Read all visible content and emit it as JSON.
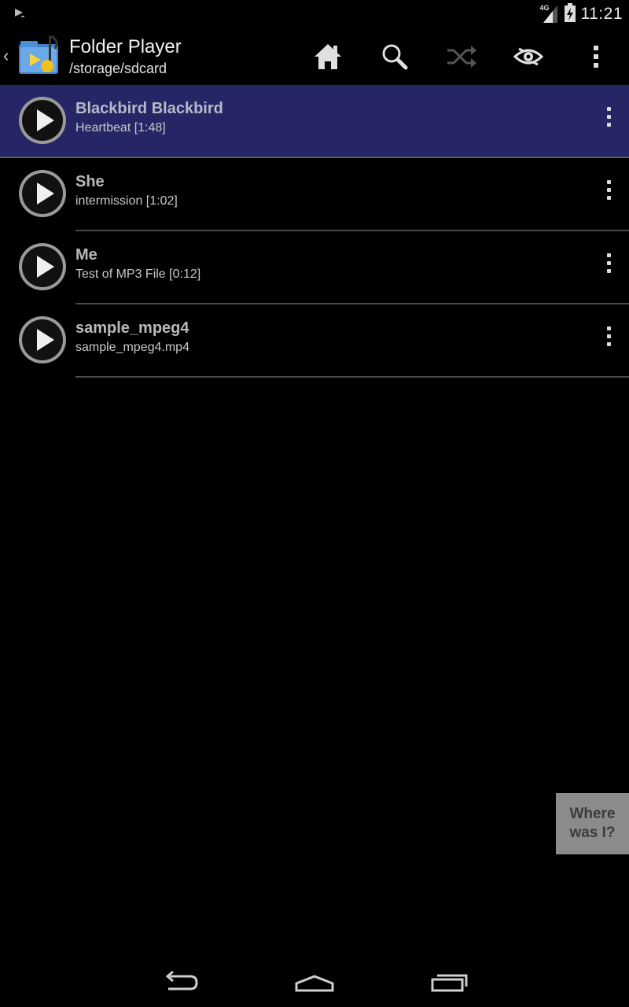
{
  "status_bar": {
    "network_type": "4G",
    "time": "11:21",
    "notification_icon": "play-store-icon",
    "signal_icon": "signal-icon",
    "battery_icon": "battery-charging-icon"
  },
  "action_bar": {
    "title": "Folder Player",
    "subtitle": "/storage/sdcard",
    "buttons": [
      "home-icon",
      "search-icon",
      "shuffle-icon",
      "eye-repeat-icon",
      "overflow-menu-icon"
    ]
  },
  "tracks": [
    {
      "title": "Blackbird Blackbird",
      "subtitle": "Heartbeat [1:48]",
      "selected": true
    },
    {
      "title": "She",
      "subtitle": "intermission [1:02]",
      "selected": false
    },
    {
      "title": "Me",
      "subtitle": "Test of MP3 File [0:12]",
      "selected": false
    },
    {
      "title": "sample_mpeg4",
      "subtitle": "sample_mpeg4.mp4",
      "selected": false
    }
  ],
  "where_was_i": {
    "line1": "Where",
    "line2": "was I?"
  },
  "colors": {
    "selected_row": "#262667",
    "background": "#000000",
    "where_button": "#8b8b8b"
  }
}
